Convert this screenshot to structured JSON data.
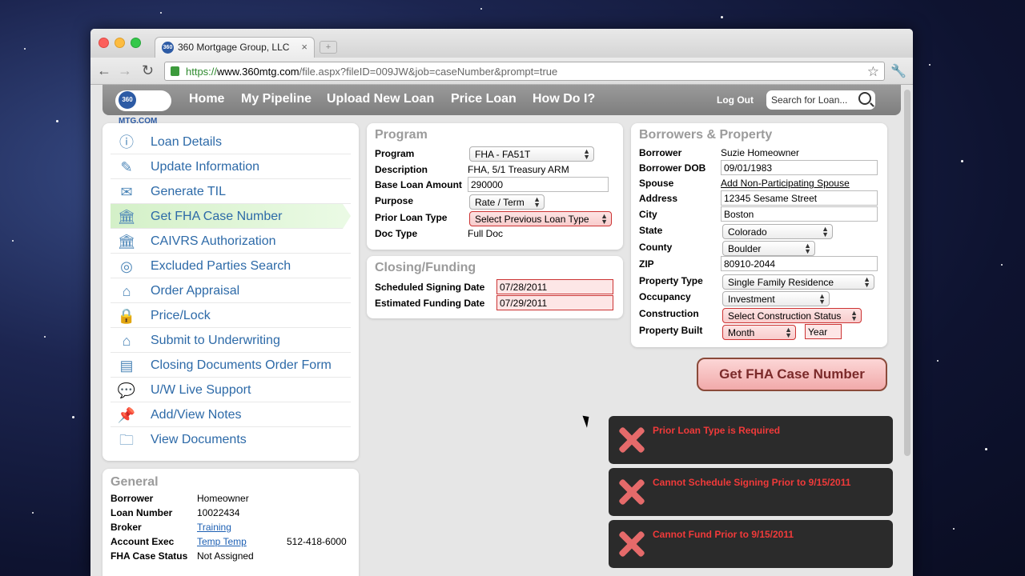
{
  "browser": {
    "tab_title": "360 Mortgage Group, LLC",
    "favicon_text": "360",
    "url_scheme": "https://",
    "url_host": "www.360mtg.com",
    "url_path": "/file.aspx?fileID=009JW&job=caseNumber&prompt=true"
  },
  "nav": {
    "logo_circle": "360",
    "logo_text": "MTG.COM",
    "links": [
      "Home",
      "My Pipeline",
      "Upload New Loan",
      "Price Loan",
      "How Do I?"
    ],
    "logout": "Log Out",
    "search_placeholder": "Search for Loan..."
  },
  "sidebar": {
    "items": [
      {
        "label": "Loan Details",
        "icon": "info-icon"
      },
      {
        "label": "Update Information",
        "icon": "pen-icon"
      },
      {
        "label": "Generate TIL",
        "icon": "document-stamp-icon"
      },
      {
        "label": "Get FHA Case Number",
        "icon": "pillar-icon"
      },
      {
        "label": "CAIVRS Authorization",
        "icon": "pillar-icon"
      },
      {
        "label": "Excluded Parties Search",
        "icon": "target-icon"
      },
      {
        "label": "Order Appraisal",
        "icon": "house-search-icon"
      },
      {
        "label": "Price/Lock",
        "icon": "lock-icon"
      },
      {
        "label": "Submit to Underwriting",
        "icon": "house-upload-icon"
      },
      {
        "label": "Closing Documents Order Form",
        "icon": "document-icon"
      },
      {
        "label": "U/W Live Support",
        "icon": "chat-icon"
      },
      {
        "label": "Add/View Notes",
        "icon": "pin-icon"
      },
      {
        "label": "View Documents",
        "icon": "folder-icon"
      }
    ],
    "active_index": 3
  },
  "general": {
    "title": "General",
    "borrower_label": "Borrower",
    "borrower": "Homeowner",
    "loan_number_label": "Loan Number",
    "loan_number": "10022434",
    "broker_label": "Broker",
    "broker": "Training",
    "account_exec_label": "Account Exec",
    "account_exec": "Temp Temp",
    "account_exec_phone": "512-418-6000",
    "fha_status_label": "FHA Case Status",
    "fha_status": "Not Assigned"
  },
  "program": {
    "title": "Program",
    "program_label": "Program",
    "program": "FHA - FA51T",
    "description_label": "Description",
    "description": "FHA, 5/1 Treasury ARM",
    "base_loan_label": "Base Loan Amount",
    "base_loan": "290000",
    "purpose_label": "Purpose",
    "purpose": "Rate / Term",
    "prior_loan_label": "Prior Loan Type",
    "prior_loan": "Select Previous Loan Type",
    "doc_type_label": "Doc Type",
    "doc_type": "Full Doc"
  },
  "closing": {
    "title": "Closing/Funding",
    "signing_label": "Scheduled Signing Date",
    "signing": "07/28/2011",
    "funding_label": "Estimated Funding Date",
    "funding": "07/29/2011"
  },
  "borrowers": {
    "title": "Borrowers & Property",
    "borrower_label": "Borrower",
    "borrower": "Suzie Homeowner",
    "dob_label": "Borrower DOB",
    "dob": "09/01/1983",
    "spouse_label": "Spouse",
    "spouse_link": "Add Non-Participating Spouse",
    "address_label": "Address",
    "address": "12345 Sesame Street",
    "city_label": "City",
    "city": "Boston",
    "state_label": "State",
    "state": "Colorado",
    "county_label": "County",
    "county": "Boulder",
    "zip_label": "ZIP",
    "zip": "80910-2044",
    "property_type_label": "Property Type",
    "property_type": "Single Family Residence",
    "occupancy_label": "Occupancy",
    "occupancy": "Investment",
    "construction_label": "Construction",
    "construction": "Select Construction Status",
    "built_label": "Property Built",
    "built_month": "Month",
    "built_year": "Year"
  },
  "action_button": "Get FHA Case Number",
  "errors": [
    "Prior Loan Type is Required",
    "Cannot Schedule Signing Prior to 9/15/2011",
    "Cannot Fund Prior to 9/15/2011"
  ]
}
